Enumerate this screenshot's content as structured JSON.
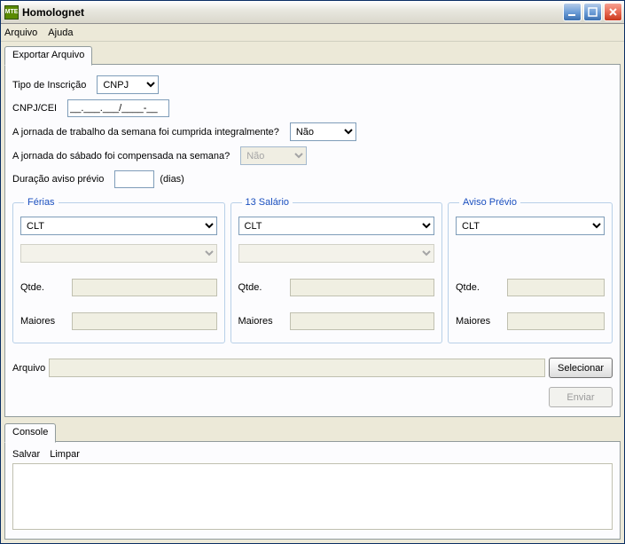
{
  "window": {
    "app_icon_label": "MTE",
    "title": "Homolognet"
  },
  "menu": {
    "arquivo": "Arquivo",
    "ajuda": "Ajuda"
  },
  "tab": {
    "exportar": "Exportar Arquivo"
  },
  "form": {
    "tipo_inscricao_label": "Tipo de Inscrição",
    "tipo_inscricao_value": "CNPJ",
    "tipo_inscricao_options": [
      "CNPJ"
    ],
    "cnpj_cei_label": "CNPJ/CEI",
    "cnpj_cei_value": "__.___.___/____-__",
    "jornada_label": "A jornada de trabalho da semana foi cumprida integralmente?",
    "jornada_value": "Não",
    "jornada_options": [
      "Não"
    ],
    "sabado_label": "A jornada do sábado foi compensada na semana?",
    "sabado_value": "Não",
    "sabado_options": [
      "Não"
    ],
    "duracao_label": "Duração aviso prévio",
    "duracao_value": "",
    "duracao_suffix": "(dias)"
  },
  "groups": {
    "ferias": {
      "legend": "Férias",
      "main_value": "CLT",
      "main_options": [
        "CLT"
      ],
      "sub_value": "",
      "qtde_label": "Qtde.",
      "qtde_value": "",
      "maiores_label": "Maiores",
      "maiores_value": ""
    },
    "decimo_terceiro": {
      "legend": "13 Salário",
      "main_value": "CLT",
      "main_options": [
        "CLT"
      ],
      "sub_value": "",
      "qtde_label": "Qtde.",
      "qtde_value": "",
      "maiores_label": "Maiores",
      "maiores_value": ""
    },
    "aviso_previo": {
      "legend": "Aviso Prévio",
      "main_value": "CLT",
      "main_options": [
        "CLT"
      ],
      "qtde_label": "Qtde.",
      "qtde_value": "",
      "maiores_label": "Maiores",
      "maiores_value": ""
    }
  },
  "arquivo": {
    "label": "Arquivo",
    "path": "",
    "selecionar": "Selecionar",
    "enviar": "Enviar"
  },
  "console": {
    "tab": "Console",
    "salvar": "Salvar",
    "limpar": "Limpar",
    "output": ""
  }
}
